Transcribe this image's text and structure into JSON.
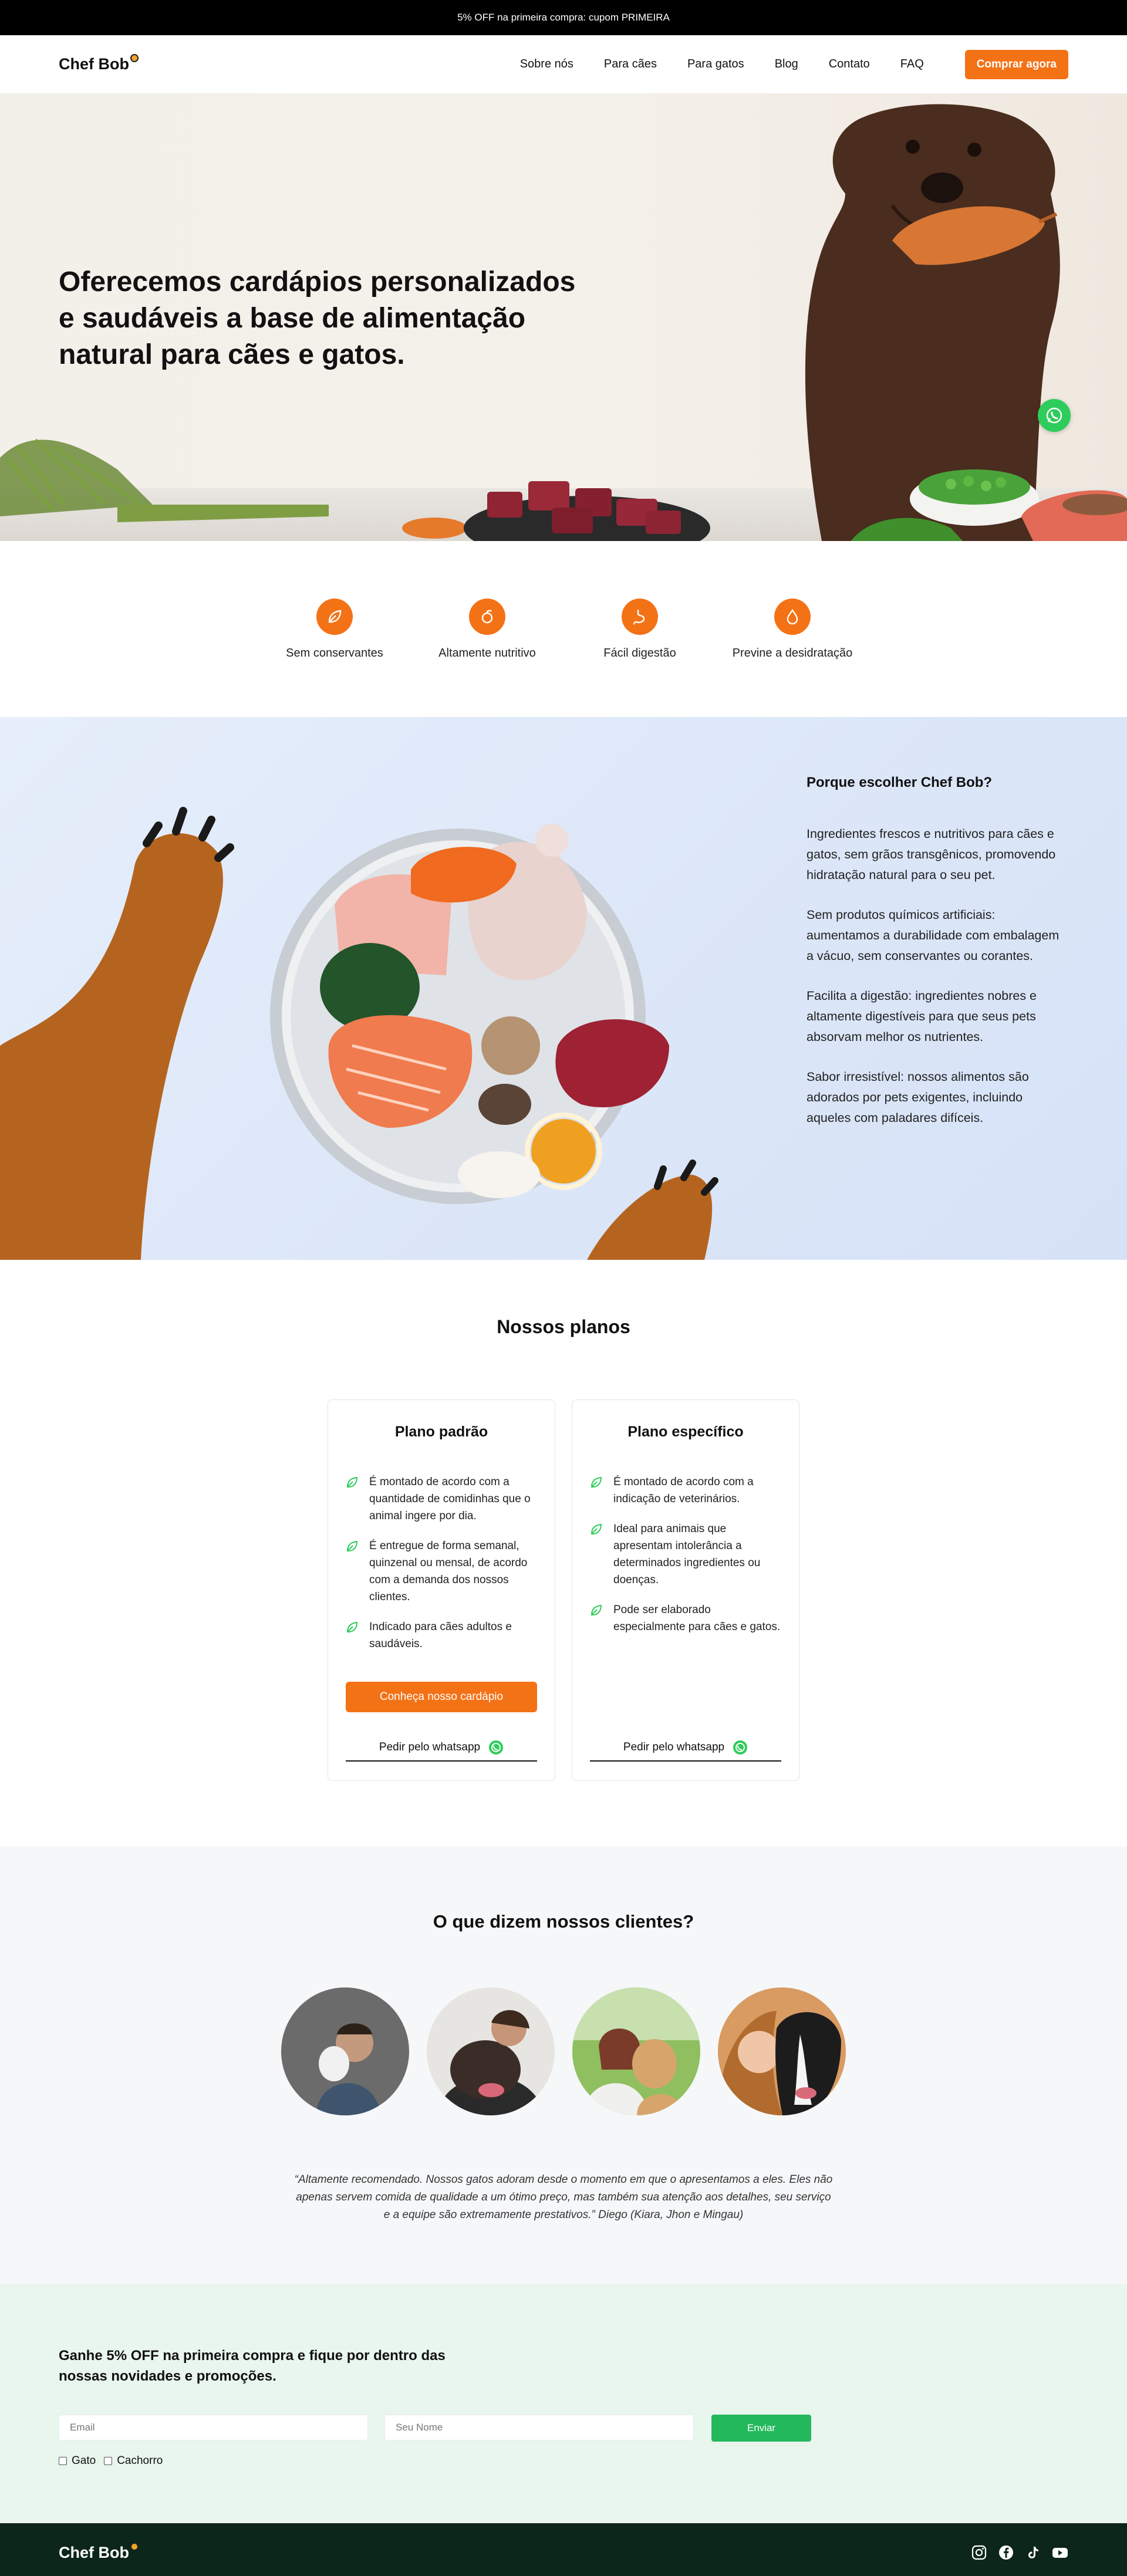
{
  "topbar": {
    "text": "5% OFF na primeira compra: cupom PRIMEIRA"
  },
  "header": {
    "logo": "Chef Bob",
    "nav": [
      "Sobre nós",
      "Para cães",
      "Para gatos",
      "Blog",
      "Contato",
      "FAQ"
    ],
    "cta": "Comprar agora"
  },
  "hero": {
    "title": "Oferecemos cardápios personalizados e saudáveis a base de alimentação natural para cães e gatos.",
    "whatsapp_icon": "whatsapp-icon"
  },
  "features": [
    {
      "label": "Sem conservantes",
      "icon": "leaf-icon"
    },
    {
      "label": "Altamente nutritivo",
      "icon": "apple-icon"
    },
    {
      "label": "Fácil digestão",
      "icon": "stomach-icon"
    },
    {
      "label": "Previne a desidratação",
      "icon": "water-drop-icon"
    }
  ],
  "why": {
    "title": "Porque escolher Chef Bob?",
    "paragraphs": [
      "Ingredientes frescos e nutritivos para cães e gatos, sem grãos transgênicos, promovendo hidratação natural para o seu pet.",
      "Sem produtos químicos artificiais: aumentamos a durabilidade com embalagem a vácuo, sem conservantes ou corantes.",
      "Facilita a digestão: ingredientes nobres e altamente digestíveis para que seus pets absorvam melhor os nutrientes.",
      "Sabor irresistível: nossos alimentos são adorados por pets exigentes, incluindo aqueles com paladares difíceis."
    ]
  },
  "plans": {
    "title": "Nossos planos",
    "cards": [
      {
        "name": "Plano padrão",
        "items": [
          "É montado de acordo com a quantidade de comidinhas que o animal ingere por dia.",
          "É entregue de forma semanal, quinzenal ou mensal, de acordo com a demanda dos nossos clientes.",
          "Indicado para cães adultos e saudáveis."
        ],
        "button": "Conheça nosso cardápio",
        "whatsapp": "Pedir pelo whatsapp"
      },
      {
        "name": "Plano específico",
        "items": [
          "É montado de acordo com a indicação de veterinários.",
          "Ideal para animais que apresentam intolerância a determinados ingredientes ou doenças.",
          "Pode ser elaborado especialmente para cães e gatos."
        ],
        "whatsapp": "Pedir pelo whatsapp"
      }
    ]
  },
  "testimonials": {
    "title": "O que dizem nossos clientes?",
    "quote": "“Altamente recomendado. Nossos gatos adoram desde o momento em que o apresentamos a eles. Eles não apenas servem comida de qualidade a um ótimo preço, mas também sua atenção aos detalhes, seu serviço e a equipe são extremamente prestativos.” Diego (Kiara, Jhon e Mingau)"
  },
  "newsletter": {
    "title": "Ganhe 5% OFF na primeira compra e fique por dentro das nossas novidades e promoções.",
    "email_placeholder": "Email",
    "name_placeholder": "Seu Nome",
    "button": "Enviar",
    "options": [
      "Gato",
      "Cachorro"
    ]
  },
  "footer": {
    "logo": "Chef Bob",
    "socials": [
      "instagram-icon",
      "facebook-icon",
      "tiktok-icon",
      "youtube-icon"
    ]
  },
  "colors": {
    "accent": "#f47216",
    "whatsapp": "#2ecc5a",
    "footer": "#0c2719",
    "send": "#23b85b"
  }
}
